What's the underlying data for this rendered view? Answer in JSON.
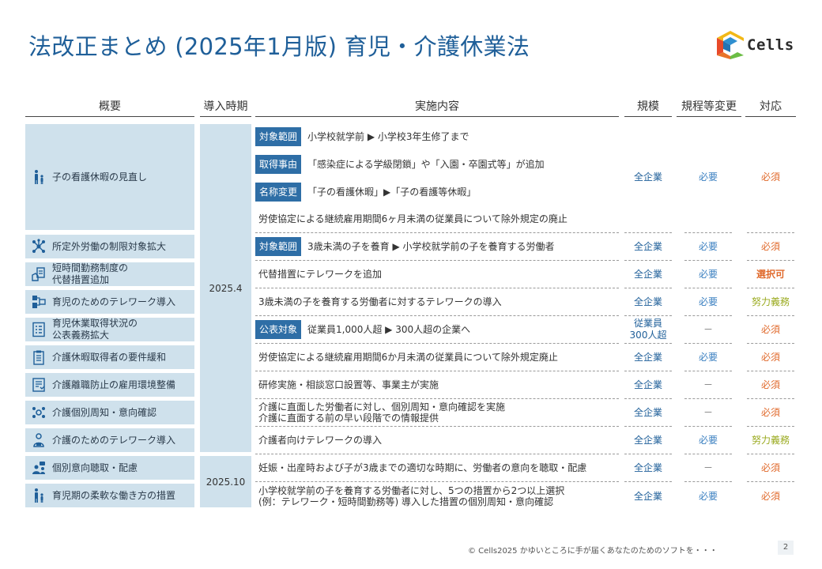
{
  "title": "法改正まとめ (2025年1月版) 育児・介護休業法",
  "brand": {
    "name": "Cells",
    "colors": [
      "#e84a2a",
      "#2f8fd0",
      "#6bbd45",
      "#f2b817"
    ]
  },
  "headers": {
    "overview": "概要",
    "date": "導入時期",
    "content": "実施内容",
    "scale": "規模",
    "rules": "規程等変更",
    "response": "対応"
  },
  "dates": {
    "d1": "2025.4",
    "d2": "2025.10"
  },
  "overview": [
    {
      "label": "子の看護休暇の見直し",
      "icon": "parent-child-icon"
    },
    {
      "label": "所定外労働の制限対象拡大",
      "icon": "network-icon"
    },
    {
      "label": "短時間勤務制度の\n代替措置追加",
      "icon": "hand-document-icon"
    },
    {
      "label": "育児のためのテレワーク導入",
      "icon": "telework-icon"
    },
    {
      "label": "育児休業取得状況の\n公表義務拡大",
      "icon": "checklist-icon"
    },
    {
      "label": "介護休暇取得者の要件緩和",
      "icon": "clipboard-icon"
    },
    {
      "label": "介護離職防止の雇用環境整備",
      "icon": "form-icon"
    },
    {
      "label": "介護個別周知・意向確認",
      "icon": "people-gear-icon"
    },
    {
      "label": "介護のためのテレワーク導入",
      "icon": "person-laptop-icon"
    },
    {
      "label": "個別意向聴取・配慮",
      "icon": "group-talk-icon"
    },
    {
      "label": "育児期の柔軟な働き方の措置",
      "icon": "parent-child-icon"
    }
  ],
  "content": [
    {
      "tag": "対象範囲",
      "text": "小学校就学前 ▶ 小学校3年生修了まで"
    },
    {
      "tag": "取得事由",
      "text": "「感染症による学級閉鎖」や「入園・卒園式等」が追加"
    },
    {
      "tag": "名称変更",
      "text": "「子の看護休暇」▶「子の看護等休暇」"
    },
    {
      "tag": "",
      "text": "労使協定による継続雇用期間6ヶ月未満の従業員について除外規定の廃止"
    },
    {
      "tag": "対象範囲",
      "text": "3歳未満の子を養育 ▶ 小学校就学前の子を養育する労働者"
    },
    {
      "tag": "",
      "text": "代替措置にテレワークを追加"
    },
    {
      "tag": "",
      "text": "3歳未満の子を養育する労働者に対するテレワークの導入"
    },
    {
      "tag": "公表対象",
      "text": "従業員1,000人超 ▶ 300人超の企業へ"
    },
    {
      "tag": "",
      "text": "労使協定による継続雇用期間6か月未満の従業員について除外規定廃止"
    },
    {
      "tag": "",
      "text": "研修実施・相談窓口設置等、事業主が実施"
    },
    {
      "tag": "",
      "text": "介護に直面した労働者に対し、個別周知・意向確認を実施\n介護に直面する前の早い段階での情報提供"
    },
    {
      "tag": "",
      "text": "介護者向けテレワークの導入"
    },
    {
      "tag": "",
      "text": "妊娠・出産時および子が3歳までの適切な時期に、労働者の意向を聴取・配慮"
    },
    {
      "tag": "",
      "text": "小学校就学前の子を養育する労働者に対し、5つの措置から2つ以上選択\n(例：テレワーク・短時間勤務等) 導入した措置の個別周知・意向確認"
    }
  ],
  "values": [
    {
      "scale": "全企業",
      "rules": "必要",
      "response": "必須"
    },
    {
      "scale": "全企業",
      "rules": "必要",
      "response": "必須"
    },
    {
      "scale": "全企業",
      "rules": "必要",
      "response": "選択可"
    },
    {
      "scale": "全企業",
      "rules": "必要",
      "response": "努力義務"
    },
    {
      "scale": "従業員\n300人超",
      "rules": "－",
      "response": "必須"
    },
    {
      "scale": "全企業",
      "rules": "必要",
      "response": "必須"
    },
    {
      "scale": "全企業",
      "rules": "－",
      "response": "必須"
    },
    {
      "scale": "全企業",
      "rules": "－",
      "response": "必須"
    },
    {
      "scale": "全企業",
      "rules": "必要",
      "response": "努力義務"
    },
    {
      "scale": "全企業",
      "rules": "－",
      "response": "必須"
    },
    {
      "scale": "全企業",
      "rules": "必要",
      "response": "必須"
    }
  ],
  "footer": "© Cells2025  かゆいところに手が届くあなたのためのソフトを・・・",
  "page_number": "2"
}
